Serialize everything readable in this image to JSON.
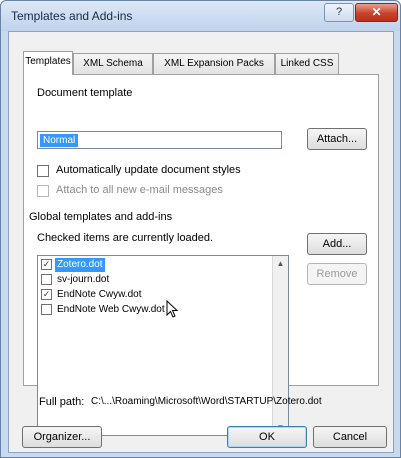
{
  "window": {
    "title": "Templates and Add-ins",
    "help_label": "?",
    "close_label": "✕"
  },
  "tabs": [
    {
      "label": "Templates",
      "active": true
    },
    {
      "label": "XML Schema",
      "active": false
    },
    {
      "label": "XML Expansion Packs",
      "active": false
    },
    {
      "label": "Linked CSS",
      "active": false
    }
  ],
  "document_template": {
    "group_label": "Document template",
    "value": "Normal",
    "attach_label": "Attach...",
    "auto_update_label": "Automatically update document styles",
    "auto_update_checked": false,
    "attach_email_label": "Attach to all new e-mail messages",
    "attach_email_checked": false
  },
  "global_templates": {
    "group_label": "Global templates and add-ins",
    "checked_note": "Checked items are currently loaded.",
    "add_label": "Add...",
    "remove_label": "Remove",
    "items": [
      {
        "name": "Zotero.dot",
        "checked": true,
        "selected": true
      },
      {
        "name": "sv-journ.dot",
        "checked": false,
        "selected": false
      },
      {
        "name": "EndNote Cwyw.dot",
        "checked": true,
        "selected": false
      },
      {
        "name": "EndNote Web Cwyw.dot",
        "checked": false,
        "selected": false
      }
    ]
  },
  "full_path": {
    "label": "Full path:",
    "value": "C:\\...\\Roaming\\Microsoft\\Word\\STARTUP\\Zotero.dot"
  },
  "buttons": {
    "organizer_label": "Organizer...",
    "ok_label": "OK",
    "cancel_label": "Cancel"
  },
  "icons": {
    "check": "✓",
    "scroll_up": "▲",
    "scroll_down": "▼"
  },
  "colors": {
    "selection": "#3399ff",
    "close_button": "#c8432c"
  }
}
